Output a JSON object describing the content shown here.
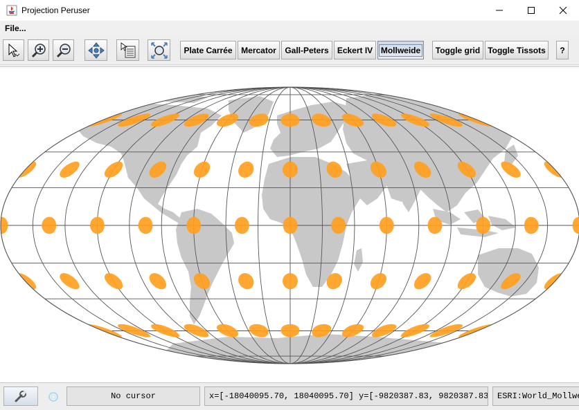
{
  "window": {
    "title": "Projection Peruser"
  },
  "menu": {
    "file_label": "File..."
  },
  "toolbar": {
    "tools": [
      "pointer-tool",
      "zoom-in-tool",
      "zoom-out-tool",
      "pan-tool",
      "info-tool",
      "zoom-to-full-extent"
    ],
    "projection_buttons": [
      "Plate Carrée",
      "Mercator",
      "Gall-Peters",
      "Eckert IV",
      "Mollweide"
    ],
    "selected_projection": "Mollweide",
    "toggle_grid_label": "Toggle grid",
    "toggle_tissots_label": "Toggle Tissots",
    "help_label": "?"
  },
  "map": {
    "projection": "Mollweide",
    "land_color": "#c8c8c8",
    "grid_color": "#555555",
    "tissot_color": "#ffa020",
    "background": "#ffffff"
  },
  "status": {
    "cursor_text": "No cursor",
    "extent_text": "x=[-18040095.70, 18040095.70] y=[-9820387.83, 9820387.83]",
    "crs_text": "ESRI:World_Mollweide"
  }
}
